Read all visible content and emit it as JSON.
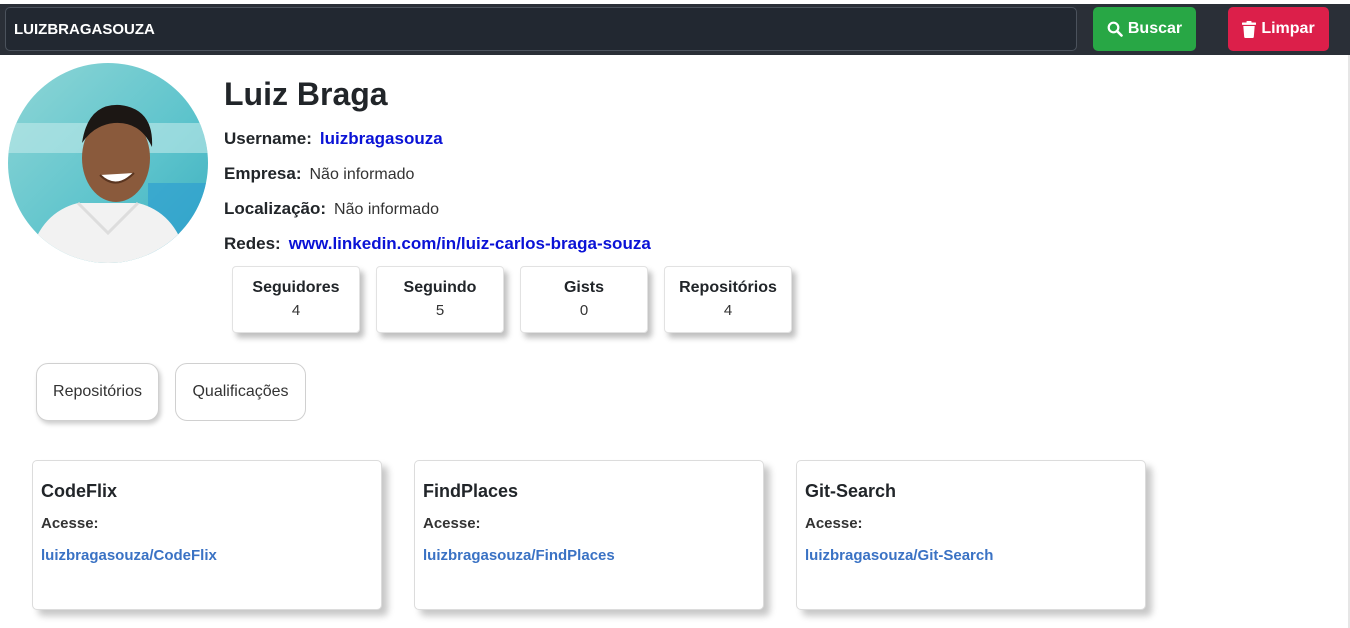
{
  "search": {
    "value": "LUIZBRAGASOUZA",
    "search_button_label": "Buscar",
    "search_icon": "search-icon",
    "clear_button_label": "Limpar",
    "clear_icon": "trash-icon"
  },
  "profile": {
    "name": "Luiz Braga",
    "username_label": "Username:",
    "username": "luizbragasouza",
    "company_label": "Empresa:",
    "company": "Não informado",
    "location_label": "Localização:",
    "location": "Não informado",
    "networks_label": "Redes:",
    "networks": "www.linkedin.com/in/luiz-carlos-braga-souza"
  },
  "stats": [
    {
      "label": "Seguidores",
      "value": "4"
    },
    {
      "label": "Seguindo",
      "value": "5"
    },
    {
      "label": "Gists",
      "value": "0"
    },
    {
      "label": "Repositórios",
      "value": "4"
    }
  ],
  "tabs": [
    {
      "label": "Repositórios"
    },
    {
      "label": "Qualificações"
    }
  ],
  "repos": [
    {
      "title": "CodeFlix",
      "access_label": "Acesse:",
      "link": "luizbragasouza/CodeFlix"
    },
    {
      "title": "FindPlaces",
      "access_label": "Acesse:",
      "link": "luizbragasouza/FindPlaces"
    },
    {
      "title": "Git-Search",
      "access_label": "Acesse:",
      "link": "luizbragasouza/Git-Search"
    }
  ],
  "colors": {
    "topbar": "#2a2f37",
    "search_button": "#28a745",
    "clear_button": "#dc1f4a",
    "profile_link": "#0a12d6",
    "repo_link": "#3a72c4"
  }
}
